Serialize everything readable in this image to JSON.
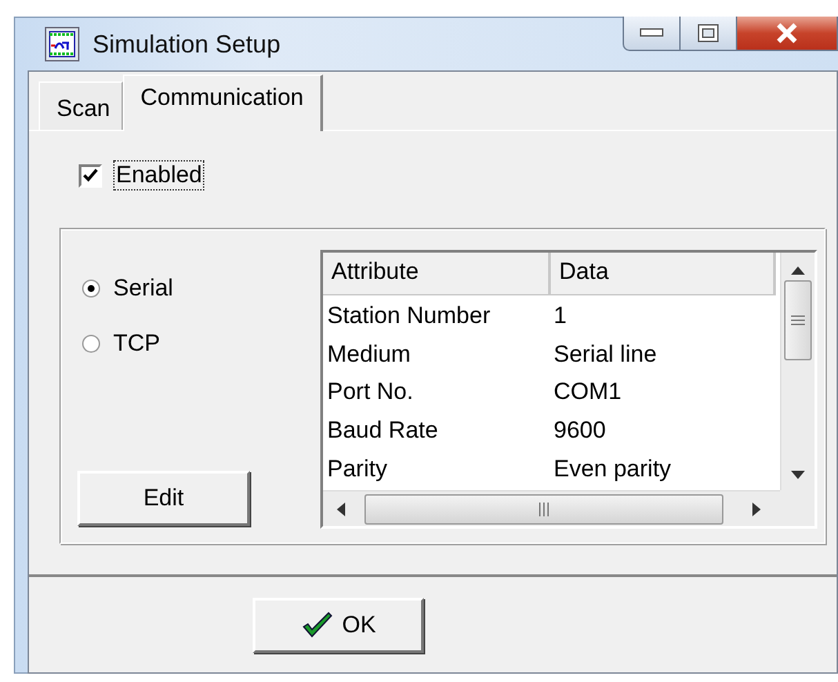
{
  "window": {
    "title": "Simulation Setup"
  },
  "tabs": [
    {
      "label": "Scan",
      "selected": false
    },
    {
      "label": "Communication",
      "selected": true
    }
  ],
  "enabled": {
    "label": "Enabled",
    "checked": true
  },
  "connection": [
    {
      "label": "Serial",
      "selected": true
    },
    {
      "label": "TCP",
      "selected": false
    }
  ],
  "edit_button": "Edit",
  "table": {
    "columns": [
      "Attribute",
      "Data"
    ],
    "rows": [
      [
        "Station Number",
        "1"
      ],
      [
        "Medium",
        "Serial line"
      ],
      [
        "Port No.",
        "COM1"
      ],
      [
        "Baud Rate",
        "9600"
      ],
      [
        "Parity",
        "Even parity"
      ]
    ]
  },
  "ok_button": "OK"
}
